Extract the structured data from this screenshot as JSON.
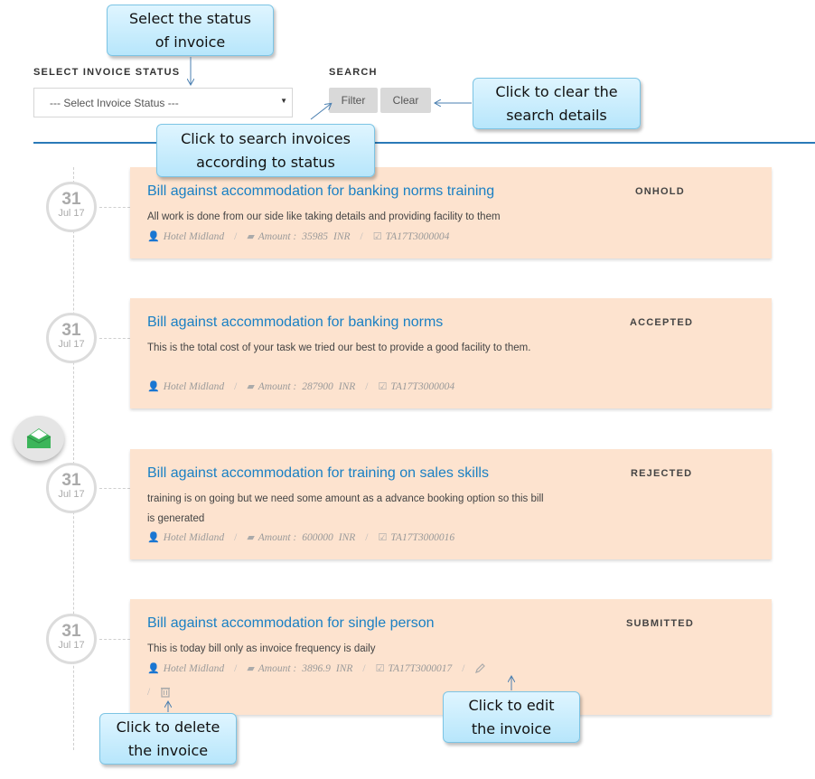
{
  "filters": {
    "status_label": "SELECT INVOICE STATUS",
    "status_select_value": "--- Select Invoice Status ---",
    "search_label": "SEARCH",
    "filter_button": "Filter",
    "clear_button": "Clear"
  },
  "invoices": [
    {
      "day": "31",
      "month": "Jul 17",
      "title": "Bill against accommodation for banking norms training",
      "description": "All work is done from our side like taking details and providing facility to them",
      "status": "ONHOLD",
      "hotel": "Hotel Midland",
      "amount_label": "Amount :",
      "amount": "35985",
      "currency": "INR",
      "ref": "TA17T3000004"
    },
    {
      "day": "31",
      "month": "Jul 17",
      "title": "Bill against accommodation for banking norms",
      "description": "This is the total cost of your task we tried our best to provide a good facility to them.",
      "status": "ACCEPTED",
      "hotel": "Hotel Midland",
      "amount_label": "Amount :",
      "amount": "287900",
      "currency": "INR",
      "ref": "TA17T3000004"
    },
    {
      "day": "31",
      "month": "Jul 17",
      "title": "Bill against accommodation for training on sales skills",
      "description": "training is on going but we need some amount as a advance booking option so this bill is generated",
      "status": "REJECTED",
      "hotel": "Hotel Midland",
      "amount_label": "Amount :",
      "amount": "600000",
      "currency": "INR",
      "ref": "TA17T3000016"
    },
    {
      "day": "31",
      "month": "Jul 17",
      "title": "Bill against accommodation for single person",
      "description": "This is today bill only as invoice frequency is daily",
      "status": "SUBMITTED",
      "hotel": "Hotel Midland",
      "amount_label": "Amount :",
      "amount": "3896.9",
      "currency": "INR",
      "ref": "TA17T3000017"
    }
  ],
  "callouts": {
    "select_status": [
      "Select  the status",
      "of invoice"
    ],
    "search": [
      "Click to search invoices",
      "according to status"
    ],
    "clear": [
      "Click to clear the",
      "search details"
    ],
    "edit": [
      "Click to edit",
      "the invoice"
    ],
    "delete": [
      "Click to delete",
      "the invoice"
    ]
  },
  "icons": {
    "user": "user-icon",
    "folder": "folder-icon",
    "check": "checkbox-icon",
    "edit": "pencil-icon",
    "delete": "trash-icon",
    "mail": "envelope-icon"
  },
  "colors": {
    "accent": "#1a80c4",
    "card_bg": "#fde3cf",
    "divider": "#2a7ab8",
    "callout_bg": "#c9eefc",
    "mail_icon": "#3cb55a"
  }
}
